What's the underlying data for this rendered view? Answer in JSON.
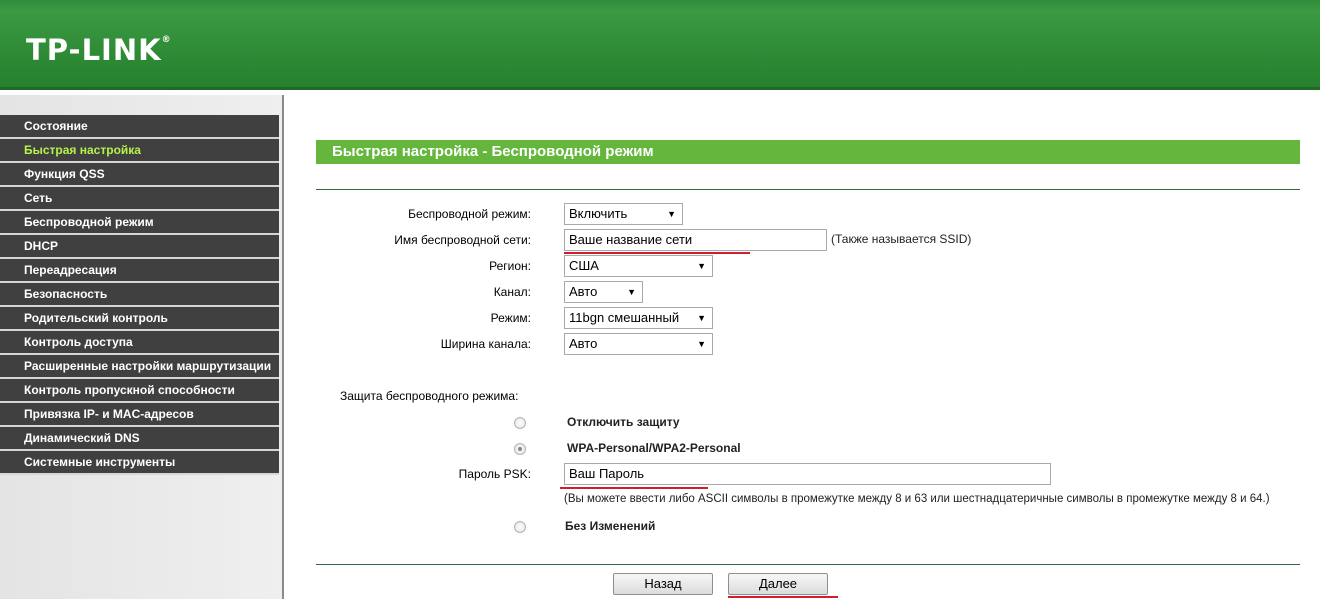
{
  "header": {
    "logo": "TP-LINK",
    "logo_mark": "®",
    "accent_color": "#2e8a35"
  },
  "sidebar": {
    "items": [
      {
        "label": "Состояние",
        "active": false
      },
      {
        "label": "Быстрая настройка",
        "active": true
      },
      {
        "label": "Функция QSS",
        "active": false
      },
      {
        "label": "Сеть",
        "active": false
      },
      {
        "label": "Беспроводной режим",
        "active": false
      },
      {
        "label": "DHCP",
        "active": false
      },
      {
        "label": "Переадресация",
        "active": false
      },
      {
        "label": "Безопасность",
        "active": false
      },
      {
        "label": "Родительский контроль",
        "active": false
      },
      {
        "label": "Контроль доступа",
        "active": false
      },
      {
        "label": "Расширенные настройки маршрутизации",
        "active": false
      },
      {
        "label": "Контроль пропускной способности",
        "active": false
      },
      {
        "label": "Привязка IP- и MAC-адресов",
        "active": false
      },
      {
        "label": "Динамический DNS",
        "active": false
      },
      {
        "label": "Системные инструменты",
        "active": false
      }
    ]
  },
  "main": {
    "title": "Быстрая настройка - Беспроводной режим",
    "wireless_mode": {
      "label": "Беспроводной режим:",
      "value": "Включить"
    },
    "ssid": {
      "label": "Имя беспроводной сети:",
      "value": "Ваше название сети",
      "hint": "(Также называется SSID)"
    },
    "region": {
      "label": "Регион:",
      "value": "США"
    },
    "channel": {
      "label": "Канал:",
      "value": "Авто"
    },
    "mode": {
      "label": "Режим:",
      "value": "11bgn смешанный"
    },
    "channel_width": {
      "label": "Ширина канала:",
      "value": "Авто"
    },
    "security": {
      "label": "Защита беспроводного режима:",
      "options": [
        {
          "label": "Отключить защиту",
          "checked": false
        },
        {
          "label": "WPA-Personal/WPA2-Personal",
          "checked": true
        },
        {
          "label": "Без Изменений",
          "checked": false
        }
      ]
    },
    "psk": {
      "label": "Пароль PSK:",
      "value": "Ваш Пароль",
      "hint": "(Вы можете ввести либо ASCII символы в промежутке между 8 и 63 или шестнадцатеричные символы в промежутке между 8 и 64.)"
    },
    "buttons": {
      "back": "Назад",
      "next": "Далее"
    },
    "highlight_color": "#d01e2a",
    "title_bar_color": "#64b73c"
  }
}
